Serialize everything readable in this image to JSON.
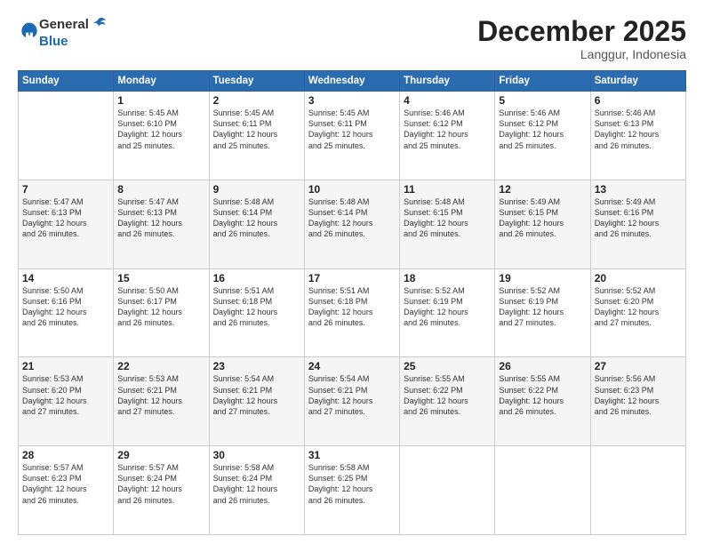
{
  "header": {
    "logo_line1": "General",
    "logo_line2": "Blue",
    "month": "December 2025",
    "location": "Langgur, Indonesia"
  },
  "weekdays": [
    "Sunday",
    "Monday",
    "Tuesday",
    "Wednesday",
    "Thursday",
    "Friday",
    "Saturday"
  ],
  "weeks": [
    [
      {
        "day": "",
        "info": ""
      },
      {
        "day": "1",
        "info": "Sunrise: 5:45 AM\nSunset: 6:10 PM\nDaylight: 12 hours\nand 25 minutes."
      },
      {
        "day": "2",
        "info": "Sunrise: 5:45 AM\nSunset: 6:11 PM\nDaylight: 12 hours\nand 25 minutes."
      },
      {
        "day": "3",
        "info": "Sunrise: 5:45 AM\nSunset: 6:11 PM\nDaylight: 12 hours\nand 25 minutes."
      },
      {
        "day": "4",
        "info": "Sunrise: 5:46 AM\nSunset: 6:12 PM\nDaylight: 12 hours\nand 25 minutes."
      },
      {
        "day": "5",
        "info": "Sunrise: 5:46 AM\nSunset: 6:12 PM\nDaylight: 12 hours\nand 25 minutes."
      },
      {
        "day": "6",
        "info": "Sunrise: 5:46 AM\nSunset: 6:13 PM\nDaylight: 12 hours\nand 26 minutes."
      }
    ],
    [
      {
        "day": "7",
        "info": "Sunrise: 5:47 AM\nSunset: 6:13 PM\nDaylight: 12 hours\nand 26 minutes."
      },
      {
        "day": "8",
        "info": "Sunrise: 5:47 AM\nSunset: 6:13 PM\nDaylight: 12 hours\nand 26 minutes."
      },
      {
        "day": "9",
        "info": "Sunrise: 5:48 AM\nSunset: 6:14 PM\nDaylight: 12 hours\nand 26 minutes."
      },
      {
        "day": "10",
        "info": "Sunrise: 5:48 AM\nSunset: 6:14 PM\nDaylight: 12 hours\nand 26 minutes."
      },
      {
        "day": "11",
        "info": "Sunrise: 5:48 AM\nSunset: 6:15 PM\nDaylight: 12 hours\nand 26 minutes."
      },
      {
        "day": "12",
        "info": "Sunrise: 5:49 AM\nSunset: 6:15 PM\nDaylight: 12 hours\nand 26 minutes."
      },
      {
        "day": "13",
        "info": "Sunrise: 5:49 AM\nSunset: 6:16 PM\nDaylight: 12 hours\nand 26 minutes."
      }
    ],
    [
      {
        "day": "14",
        "info": "Sunrise: 5:50 AM\nSunset: 6:16 PM\nDaylight: 12 hours\nand 26 minutes."
      },
      {
        "day": "15",
        "info": "Sunrise: 5:50 AM\nSunset: 6:17 PM\nDaylight: 12 hours\nand 26 minutes."
      },
      {
        "day": "16",
        "info": "Sunrise: 5:51 AM\nSunset: 6:18 PM\nDaylight: 12 hours\nand 26 minutes."
      },
      {
        "day": "17",
        "info": "Sunrise: 5:51 AM\nSunset: 6:18 PM\nDaylight: 12 hours\nand 26 minutes."
      },
      {
        "day": "18",
        "info": "Sunrise: 5:52 AM\nSunset: 6:19 PM\nDaylight: 12 hours\nand 26 minutes."
      },
      {
        "day": "19",
        "info": "Sunrise: 5:52 AM\nSunset: 6:19 PM\nDaylight: 12 hours\nand 27 minutes."
      },
      {
        "day": "20",
        "info": "Sunrise: 5:52 AM\nSunset: 6:20 PM\nDaylight: 12 hours\nand 27 minutes."
      }
    ],
    [
      {
        "day": "21",
        "info": "Sunrise: 5:53 AM\nSunset: 6:20 PM\nDaylight: 12 hours\nand 27 minutes."
      },
      {
        "day": "22",
        "info": "Sunrise: 5:53 AM\nSunset: 6:21 PM\nDaylight: 12 hours\nand 27 minutes."
      },
      {
        "day": "23",
        "info": "Sunrise: 5:54 AM\nSunset: 6:21 PM\nDaylight: 12 hours\nand 27 minutes."
      },
      {
        "day": "24",
        "info": "Sunrise: 5:54 AM\nSunset: 6:21 PM\nDaylight: 12 hours\nand 27 minutes."
      },
      {
        "day": "25",
        "info": "Sunrise: 5:55 AM\nSunset: 6:22 PM\nDaylight: 12 hours\nand 26 minutes."
      },
      {
        "day": "26",
        "info": "Sunrise: 5:55 AM\nSunset: 6:22 PM\nDaylight: 12 hours\nand 26 minutes."
      },
      {
        "day": "27",
        "info": "Sunrise: 5:56 AM\nSunset: 6:23 PM\nDaylight: 12 hours\nand 26 minutes."
      }
    ],
    [
      {
        "day": "28",
        "info": "Sunrise: 5:57 AM\nSunset: 6:23 PM\nDaylight: 12 hours\nand 26 minutes."
      },
      {
        "day": "29",
        "info": "Sunrise: 5:57 AM\nSunset: 6:24 PM\nDaylight: 12 hours\nand 26 minutes."
      },
      {
        "day": "30",
        "info": "Sunrise: 5:58 AM\nSunset: 6:24 PM\nDaylight: 12 hours\nand 26 minutes."
      },
      {
        "day": "31",
        "info": "Sunrise: 5:58 AM\nSunset: 6:25 PM\nDaylight: 12 hours\nand 26 minutes."
      },
      {
        "day": "",
        "info": ""
      },
      {
        "day": "",
        "info": ""
      },
      {
        "day": "",
        "info": ""
      }
    ]
  ]
}
